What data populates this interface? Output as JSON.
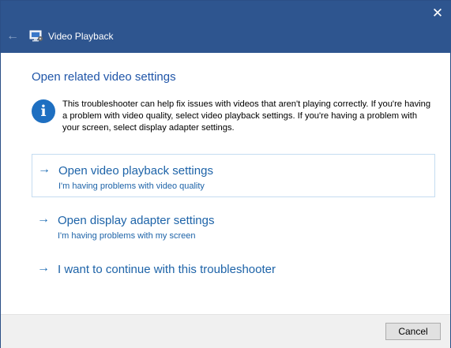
{
  "titlebar": {
    "app_title": "Video Playback",
    "back_icon": "←",
    "close_icon": "✕"
  },
  "main": {
    "heading": "Open related video settings",
    "info_icon": "i",
    "info_text": "This troubleshooter can help fix issues with videos that aren't playing correctly. If you're having a problem with video quality, select video playback settings. If you're having a problem with your screen, select display adapter settings.",
    "arrow": "→",
    "options": [
      {
        "title": "Open video playback settings",
        "subtitle": "I'm having problems with video quality"
      },
      {
        "title": "Open display adapter settings",
        "subtitle": "I'm having problems with my screen"
      },
      {
        "title": "I want to continue with this troubleshooter",
        "subtitle": ""
      }
    ]
  },
  "footer": {
    "cancel_label": "Cancel"
  },
  "colors": {
    "titlebar": "#2e558f",
    "accent": "#1d63a8",
    "info_icon": "#1e6fc1"
  }
}
